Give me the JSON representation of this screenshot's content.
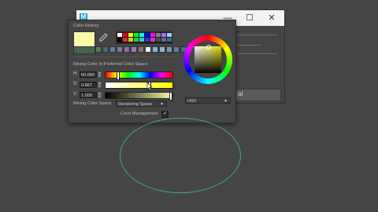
{
  "bg_window": {
    "app_icon": "M",
    "minimize": "—",
    "maximize": "☐",
    "close": "✕",
    "field_value": "al"
  },
  "picker": {
    "color_history_label": "Color History",
    "mixing_label": "Mixing Color In Preferred Color Space",
    "h": {
      "label": "H:",
      "value": "60.000",
      "fraction": 0.17
    },
    "s": {
      "label": "S:",
      "value": "0.667",
      "fraction": 0.667
    },
    "v": {
      "label": "V:",
      "value": "1.000",
      "fraction": 1.0
    },
    "mixing_space_label": "Mixing Color Space",
    "mixing_space_value": "Rendering Space",
    "color_management_label": "Color Management",
    "color_management_checked": "✓",
    "wheel_mode": "HSV",
    "current_color": "#fafaa8",
    "previous_color": "#44664a"
  },
  "palette_row1": [
    "#ffffff",
    "#ff0000",
    "#ffff00",
    "#00ff00",
    "#00ffff",
    "#0000ff",
    "#ff00ff",
    "#7f7f7f",
    "#b266ff",
    "#99ccff"
  ],
  "palette_row2": [
    "#000000",
    "#cc3333",
    "#cccc33",
    "#33cc33",
    "#33cccc",
    "#3333cc",
    "#cc33cc",
    "#4c4c4c",
    "#666699",
    "#336699"
  ],
  "history": [
    "#5c7a60",
    "#3a6f7a",
    "#6d7aa0",
    "#7a7aa0",
    "#9a6aa0",
    "#a07ab4",
    "#7a7a7a",
    "#f0f0f0",
    "#89b4d8",
    "#9bb3c9",
    "#7a9ab4",
    "#5f7f9f",
    "#4a6a8a",
    "#3a4a6a",
    "#8c8c8c"
  ]
}
